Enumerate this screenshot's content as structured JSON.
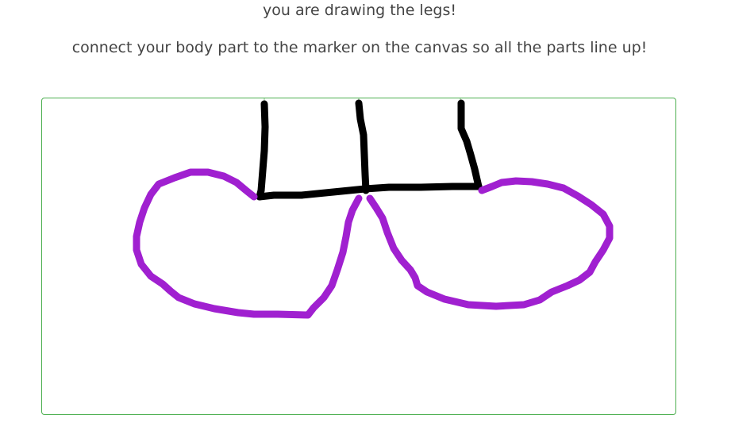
{
  "instructions": {
    "title": "you are drawing the legs!",
    "subtitle": "connect your body part to the marker on the canvas so all the parts line up!"
  },
  "canvas": {
    "border_color": "#4caf50",
    "background": "#ffffff"
  },
  "strokes": {
    "black_color": "#000000",
    "purple_color": "#a020d0"
  }
}
